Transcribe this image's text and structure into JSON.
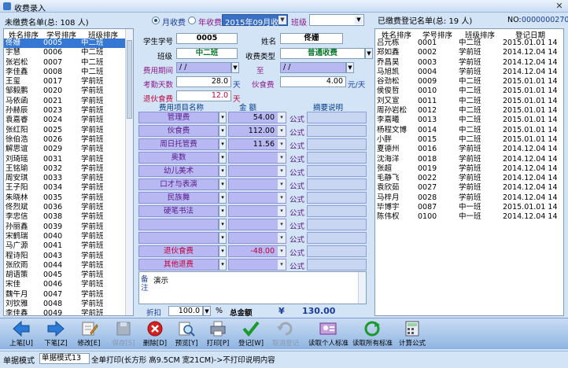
{
  "window": {
    "title": "收费录入"
  },
  "topbar": {
    "unpaid_label": "未缴费名单(总: 108 人)",
    "mode_monthly": "月收费",
    "mode_yearly": "年收费",
    "month_value": "2015年09月收费",
    "class_label": "班级",
    "class_value": ""
  },
  "no": {
    "label": "NO:",
    "value": "0000000270"
  },
  "left_list": {
    "headers": [
      "姓名排序",
      "学号排序",
      "班级排序"
    ],
    "rows": [
      [
        "佟姗",
        "0005",
        "中二班"
      ],
      [
        "宇慧",
        "0006",
        "中二班"
      ],
      [
        "张岩松",
        "0007",
        "中二班"
      ],
      [
        "李佳鑫",
        "0008",
        "中二班"
      ],
      [
        "王玺",
        "0017",
        "学前班"
      ],
      [
        "邹毅鹏",
        "0020",
        "学前班"
      ],
      [
        "马依函",
        "0021",
        "学前班"
      ],
      [
        "孙赫辰",
        "0023",
        "学前班"
      ],
      [
        "袁嘉睿",
        "0024",
        "学前班"
      ],
      [
        "张红阳",
        "0025",
        "学前班"
      ],
      [
        "徐伯浩",
        "0026",
        "学前班"
      ],
      [
        "解思谊",
        "0029",
        "学前班"
      ],
      [
        "刘琦瑶",
        "0031",
        "学前班"
      ],
      [
        "王铭瑜",
        "0032",
        "学前班"
      ],
      [
        "周安琪",
        "0033",
        "学前班"
      ],
      [
        "王子阳",
        "0034",
        "学前班"
      ],
      [
        "朱晓林",
        "0035",
        "学前班"
      ],
      [
        "佟烈斌",
        "0036",
        "学前班"
      ],
      [
        "李忠信",
        "0038",
        "学前班"
      ],
      [
        "孙丽鑫",
        "0039",
        "学前班"
      ],
      [
        "宋鹤瑞",
        "0040",
        "学前班"
      ],
      [
        "马广源",
        "0041",
        "学前班"
      ],
      [
        "程诗阳",
        "0043",
        "学前班"
      ],
      [
        "张欣雨",
        "0044",
        "学前班"
      ],
      [
        "胡语策",
        "0045",
        "学前班"
      ],
      [
        "宋佳",
        "0046",
        "学前班"
      ],
      [
        "魏午月",
        "0047",
        "学前班"
      ],
      [
        "刘钦雅",
        "0048",
        "学前班"
      ],
      [
        "李佳鑫",
        "0049",
        "学前班"
      ],
      [
        "李思旋",
        "0050",
        "学前班"
      ]
    ]
  },
  "form": {
    "student_id_label": "学生学号",
    "student_id": "0005",
    "name_label": "姓名",
    "name": "佟姗",
    "class_label": "班级",
    "class": "中二班",
    "fee_type_label": "收费类型",
    "fee_type": "普通收费",
    "period_label": "费用期间",
    "period_from": "/ /",
    "to_label": "至",
    "period_to": "/ /",
    "attendance_label": "考勤天数",
    "attendance": "28.0",
    "attendance_unit": "天",
    "meal_fee_label": "伙食费",
    "meal_fee": "4.00",
    "meal_fee_unit": "元/天",
    "refund_label": "退伙食费",
    "refund_days": "12.0",
    "refund_unit": "天",
    "col_item": "费用项目名称",
    "col_amount": "金    额",
    "col_note": "摘要说明",
    "fees": [
      {
        "name": "管理费",
        "amount": "54.00",
        "formula": "公式"
      },
      {
        "name": "伙食费",
        "amount": "112.00",
        "formula": "公式"
      },
      {
        "name": "周日托管费",
        "amount": "11.56",
        "formula": "公式"
      },
      {
        "name": "奥数",
        "amount": "",
        "formula": "公式"
      },
      {
        "name": "幼儿美术",
        "amount": "",
        "formula": "公式"
      },
      {
        "name": "口才与表演",
        "amount": "",
        "formula": "公式"
      },
      {
        "name": "民族舞",
        "amount": "",
        "formula": "公式"
      },
      {
        "name": "硬笔书法",
        "amount": "",
        "formula": "公式"
      },
      {
        "name": "",
        "amount": "",
        "formula": "公式"
      },
      {
        "name": "",
        "amount": "",
        "formula": "公式"
      },
      {
        "name": "退伙食费",
        "amount": "-48.00",
        "formula": "公式",
        "red": true
      },
      {
        "name": "其他退费",
        "amount": "",
        "formula": "公式",
        "red": true
      }
    ],
    "remark_label": "备注",
    "remark_text": "演示",
    "discount_label": "折扣",
    "discount": "100.0",
    "discount_unit": "%",
    "total_label": "总金额",
    "total_symbol": "¥",
    "total": "130.00"
  },
  "right_list": {
    "title": "已缴费登记名单(总: 19 人)",
    "headers": [
      "姓名排序",
      "学号排序",
      "班级排序",
      "登记日期"
    ],
    "rows": [
      [
        "吕元栋",
        "0001",
        "中二班",
        "2015.01.01 14:33"
      ],
      [
        "郑如鑫",
        "0002",
        "学前班",
        "2014.12.04 14:33"
      ],
      [
        "乔昌昊",
        "0003",
        "学前班",
        "2014.12.04 14:33"
      ],
      [
        "马旭凯",
        "0004",
        "学前班",
        "2014.12.04 14:33"
      ],
      [
        "谷劲松",
        "0009",
        "中二班",
        "2015.01.01 14:33"
      ],
      [
        "侯俊哲",
        "0010",
        "中二班",
        "2015.01.01 14:33"
      ],
      [
        "刘又宣",
        "0011",
        "中二班",
        "2015.01.01 14:33"
      ],
      [
        "周孙岩松",
        "0012",
        "中二班",
        "2015.01.01 14:33"
      ],
      [
        "李嘉曦",
        "0013",
        "中二班",
        "2015.01.01 14:33"
      ],
      [
        "杨程文博",
        "0014",
        "中二班",
        "2015.01.01 14:33"
      ],
      [
        "小胖",
        "0015",
        "中二班",
        "2015.01.01 14:33"
      ],
      [
        "夏德州",
        "0016",
        "学前班",
        "2014.12.04 14:33"
      ],
      [
        "沈海洋",
        "0018",
        "学前班",
        "2014.12.04 14:33"
      ],
      [
        "张超",
        "0019",
        "学前班",
        "2014.12.04 14:33"
      ],
      [
        "毛静飞",
        "0022",
        "学前班",
        "2014.12.04 14:33"
      ],
      [
        "袁欣茹",
        "0027",
        "学前班",
        "2014.12.04 14:33"
      ],
      [
        "马梓月",
        "0028",
        "学前班",
        "2014.12.04 14:33"
      ],
      [
        "毕博宇",
        "0087",
        "中一班",
        "2015.01.01 14:33"
      ],
      [
        "陈伟权",
        "0100",
        "中一班",
        "2014.12.04 14:33"
      ]
    ]
  },
  "toolbar": {
    "up": "上笔[U]",
    "down": "下笔[Z]",
    "edit": "修改[E]",
    "save": "保存[S]",
    "delete": "删除[D]",
    "preview": "预览[Y]",
    "print": "打印[P]",
    "register": "登记[W]",
    "cancel_register": "取消登记",
    "read_personal": "读取个人标准",
    "read_all": "读取所有标准",
    "calc": "计算公式"
  },
  "status": {
    "mode_label": "单据模式",
    "mode_value": "单据模式13",
    "description": "全单打印(长方形 高9.5CM 宽21CM)->不打印说明内容"
  },
  "colors": {
    "selection": "#3478d4",
    "accent": "#b8b8f2",
    "total": "#1a3c9a",
    "refund": "#c0003a"
  }
}
